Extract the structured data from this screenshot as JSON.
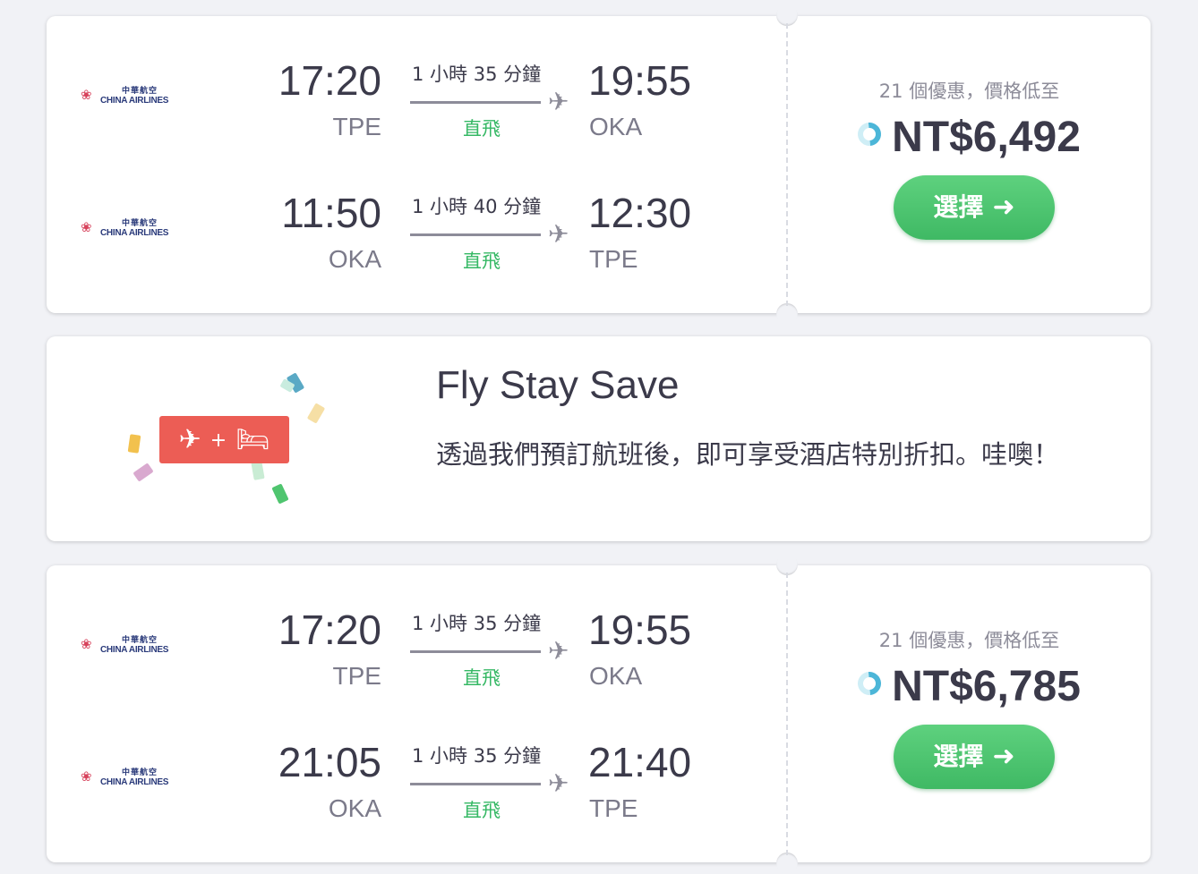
{
  "results": [
    {
      "legs": [
        {
          "airline": "CHINA AIRLINES",
          "airline_cjk": "中華航空",
          "dep_time": "17:20",
          "dep_code": "TPE",
          "duration": "1 小時 35 分鐘",
          "stops": "直飛",
          "arr_time": "19:55",
          "arr_code": "OKA"
        },
        {
          "airline": "CHINA AIRLINES",
          "airline_cjk": "中華航空",
          "dep_time": "11:50",
          "dep_code": "OKA",
          "duration": "1 小時 40 分鐘",
          "stops": "直飛",
          "arr_time": "12:30",
          "arr_code": "TPE"
        }
      ],
      "deals": "21 個優惠，價格低至",
      "price": "NT$6,492",
      "select_label": "選擇"
    },
    {
      "legs": [
        {
          "airline": "CHINA AIRLINES",
          "airline_cjk": "中華航空",
          "dep_time": "17:20",
          "dep_code": "TPE",
          "duration": "1 小時 35 分鐘",
          "stops": "直飛",
          "arr_time": "19:55",
          "arr_code": "OKA"
        },
        {
          "airline": "CHINA AIRLINES",
          "airline_cjk": "中華航空",
          "dep_time": "21:05",
          "dep_code": "OKA",
          "duration": "1 小時 35 分鐘",
          "stops": "直飛",
          "arr_time": "21:40",
          "arr_code": "TPE"
        }
      ],
      "deals": "21 個優惠，價格低至",
      "price": "NT$6,785",
      "select_label": "選擇"
    }
  ],
  "promo": {
    "title": "Fly Stay Save",
    "text": "透過我們預訂航班後，即可享受酒店特別折扣。哇噢！",
    "badge_plus": "+"
  },
  "icons": {
    "plane": "airplane-icon",
    "bed": "bed-icon",
    "arrow": "arrow-right-icon",
    "spinner": "loading-spinner-icon"
  },
  "colors": {
    "accent_green": "#3fb964",
    "direct_green": "#35b864",
    "promo_red": "#ec5d55",
    "spinner_blue": "#4cb6d8"
  }
}
